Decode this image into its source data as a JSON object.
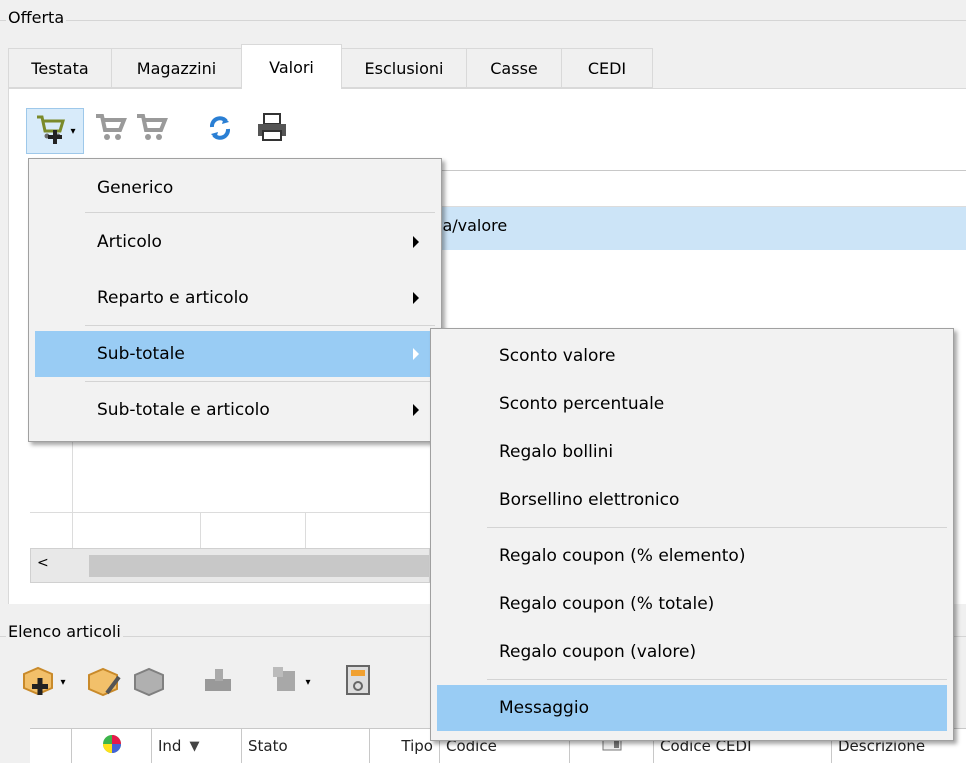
{
  "group_offer": {
    "title": "Offerta"
  },
  "tabs": [
    {
      "label": "Testata"
    },
    {
      "label": "Magazzini"
    },
    {
      "label": "Valori",
      "active": true
    },
    {
      "label": "Esclusioni"
    },
    {
      "label": "Casse"
    },
    {
      "label": "CEDI"
    }
  ],
  "toolbar": {
    "icons": [
      "cart-add-icon",
      "dropdown-arrow-icon",
      "cart-edit-icon",
      "cart-remove-icon",
      "refresh-icon",
      "print-icon"
    ]
  },
  "grid": {
    "visible_cell_text": "ia/valore"
  },
  "main_menu": {
    "items": [
      {
        "label": "Generico",
        "submenu": false
      },
      {
        "label": "Articolo",
        "submenu": true
      },
      {
        "label": "Reparto e articolo",
        "submenu": true
      },
      {
        "label": "Sub-totale",
        "submenu": true,
        "highlighted": true
      },
      {
        "label": "Sub-totale e articolo",
        "submenu": true
      }
    ]
  },
  "sub_menu": {
    "items": [
      {
        "label": "Sconto valore"
      },
      {
        "label": "Sconto percentuale"
      },
      {
        "label": "Regalo bollini"
      },
      {
        "label": "Borsellino elettronico"
      },
      {
        "label": "Regalo coupon (% elemento)"
      },
      {
        "label": "Regalo coupon (% totale)"
      },
      {
        "label": "Regalo coupon (valore)"
      },
      {
        "label": "Messaggio",
        "highlighted": true
      }
    ]
  },
  "group_articles": {
    "title": "Elenco articoli"
  },
  "articles_table": {
    "columns": [
      "",
      "",
      "Ind",
      "Stato",
      "Tipo",
      "Codice",
      "",
      "Codice CEDI",
      "Descrizione"
    ]
  },
  "colors": {
    "highlight": "#99ccf4",
    "menu_bg": "#f2f2f2",
    "panel_bg": "#f0f0f0"
  }
}
